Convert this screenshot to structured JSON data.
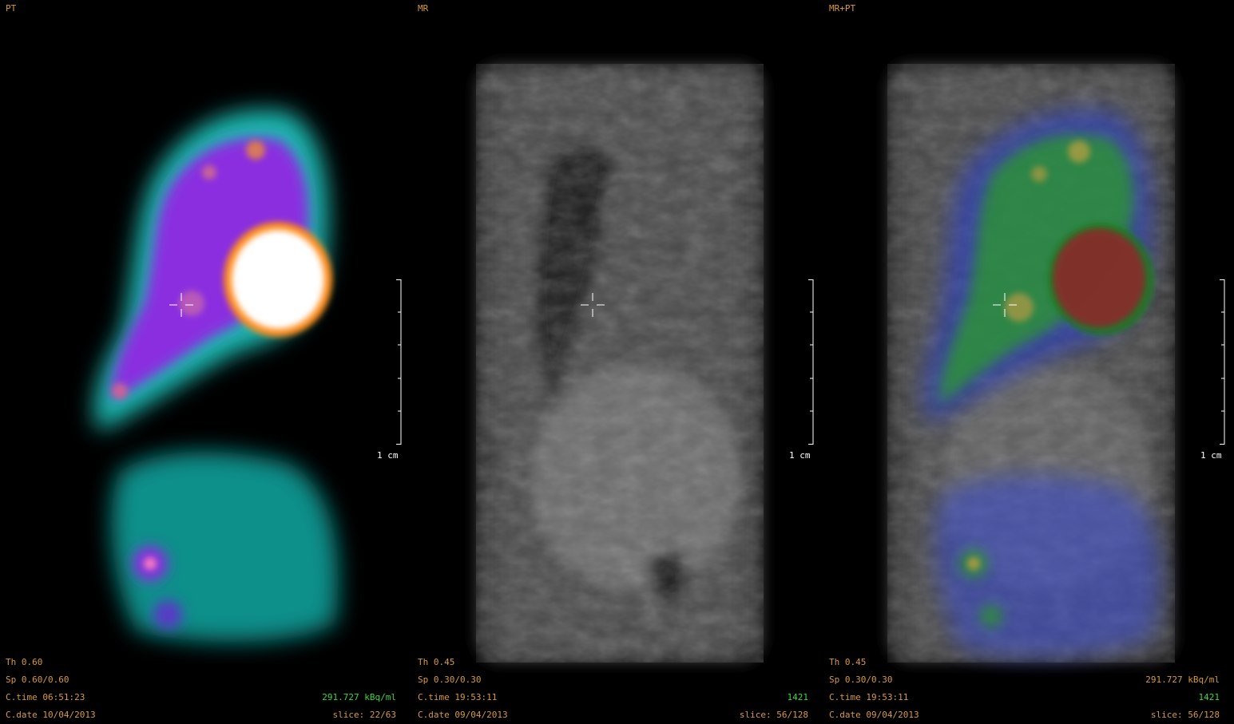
{
  "panels": [
    {
      "title": "PT",
      "threshold": "Th 0.60",
      "spacing": "Sp 0.60/0.60",
      "ctime": "C.time 06:51:23",
      "cdate": "C.date 10/04/2013",
      "value": "291.727 kBq/ml",
      "slice": "slice: 22/63",
      "scale_label": "1 cm"
    },
    {
      "title": "MR",
      "threshold": "Th 0.45",
      "spacing": "Sp 0.30/0.30",
      "ctime": "C.time 19:53:11",
      "cdate": "C.date 09/04/2013",
      "value": "1421",
      "slice": "slice: 56/128",
      "scale_label": "1 cm"
    },
    {
      "title": "MR+PT",
      "threshold": "Th 0.45",
      "spacing": "Sp 0.30/0.30",
      "ctime": "C.time 19:53:11",
      "cdate": "C.date 09/04/2013",
      "value_pt": "291.727 kBq/ml",
      "value_mr": "1421",
      "slice": "slice: 56/128",
      "scale_label": "1 cm"
    }
  ],
  "colors": {
    "overlay_text": "#d79a3c",
    "value_text": "#3bd93b",
    "scale_text": "#ffffff"
  }
}
